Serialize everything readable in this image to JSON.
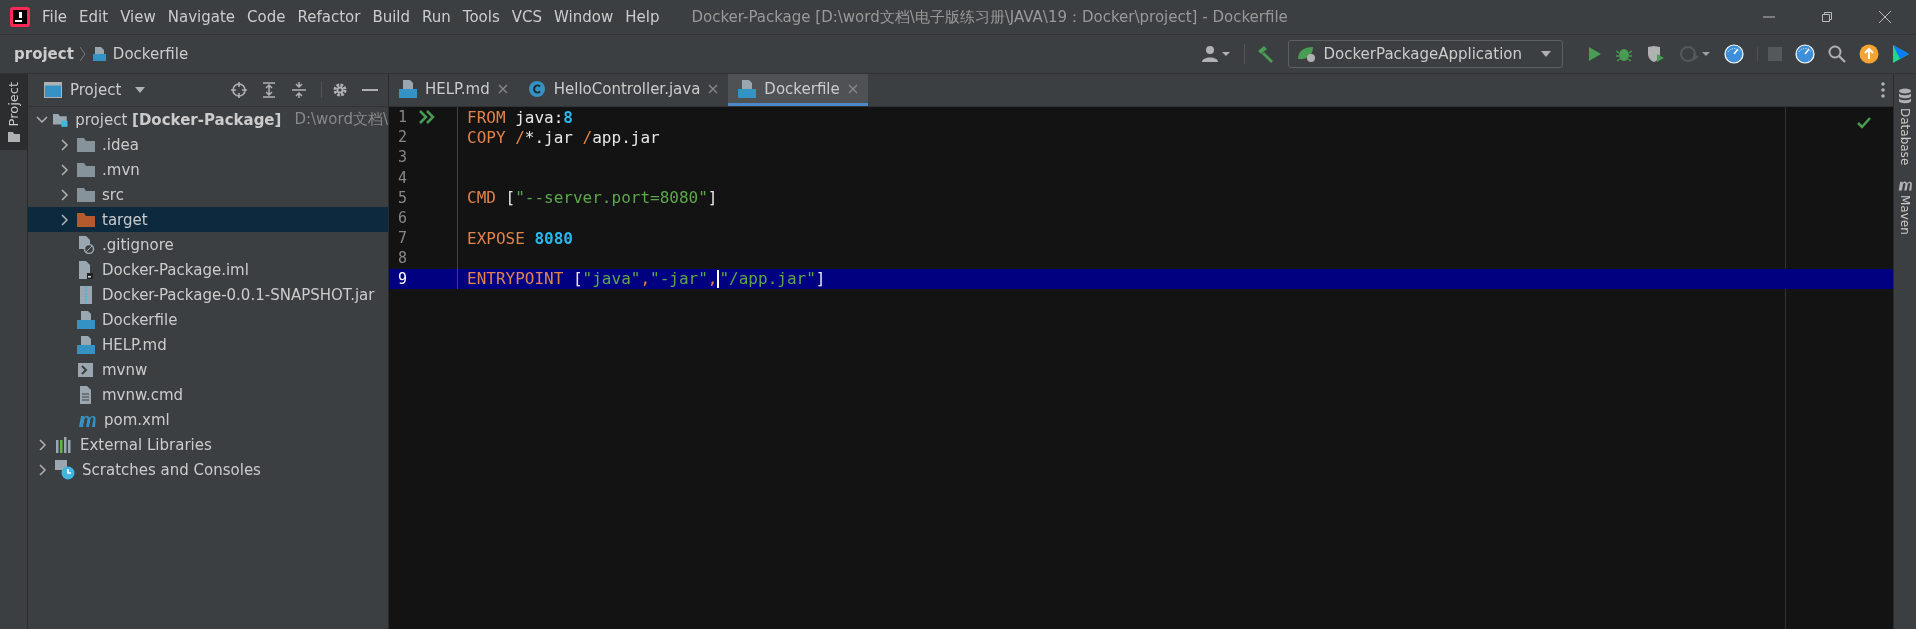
{
  "window": {
    "title": "Docker-Package [D:\\word文档\\电子版练习册\\JAVA\\19：Docker\\project] - Dockerfile"
  },
  "menu": [
    "File",
    "Edit",
    "View",
    "Navigate",
    "Code",
    "Refactor",
    "Build",
    "Run",
    "Tools",
    "VCS",
    "Window",
    "Help"
  ],
  "breadcrumb": [
    {
      "label": "project",
      "kind": "project"
    },
    {
      "label": "Dockerfile",
      "kind": "docker"
    }
  ],
  "toolbar": [
    {
      "kind": "user",
      "disabled": false
    },
    {
      "kind": "build",
      "disabled": false
    },
    {
      "kind": "config",
      "label": "DockerPackageApplication",
      "disabled": false
    },
    {
      "kind": "run",
      "disabled": false
    },
    {
      "kind": "debug",
      "disabled": false
    },
    {
      "kind": "coverage",
      "disabled": false
    },
    {
      "kind": "profile",
      "disabled": true
    },
    {
      "kind": "gauge",
      "disabled": false
    },
    {
      "kind": "stop",
      "disabled": true
    },
    {
      "kind": "gauge",
      "disabled": false
    },
    {
      "kind": "search",
      "disabled": false
    },
    {
      "kind": "update",
      "disabled": false
    },
    {
      "kind": "toolbox",
      "disabled": false
    }
  ],
  "left_strip": [
    {
      "label": "Project",
      "selected": true
    }
  ],
  "right_strip": [
    {
      "label": "Database",
      "kind": "database"
    },
    {
      "label": "Maven",
      "kind": "maven"
    }
  ],
  "project_panel": {
    "title": "Project",
    "tree": [
      {
        "label": "project **[Docker-Package]**",
        "path": "D:\\word文档\\",
        "kind": "module",
        "expanded": true,
        "selected": false,
        "children": [
          {
            "label": ".idea",
            "kind": "folder",
            "expanded": false,
            "selected": false
          },
          {
            "label": ".mvn",
            "kind": "folder",
            "expanded": false,
            "selected": false
          },
          {
            "label": "src",
            "kind": "folder",
            "expanded": false,
            "selected": false
          },
          {
            "label": "target",
            "kind": "excluded",
            "expanded": false,
            "selected": true
          },
          {
            "label": ".gitignore",
            "kind": "gitignore",
            "selected": false
          },
          {
            "label": "Docker-Package.iml",
            "kind": "iml",
            "selected": false
          },
          {
            "label": "Docker-Package-0.0.1-SNAPSHOT.jar",
            "kind": "jar",
            "selected": false
          },
          {
            "label": "Dockerfile",
            "kind": "docker",
            "selected": false
          },
          {
            "label": "HELP.md",
            "kind": "md",
            "selected": false
          },
          {
            "label": "mvnw",
            "kind": "shell",
            "selected": false
          },
          {
            "label": "mvnw.cmd",
            "kind": "text",
            "selected": false
          },
          {
            "label": "pom.xml",
            "kind": "maven",
            "selected": false
          }
        ]
      },
      {
        "label": "External Libraries",
        "kind": "libraries",
        "expanded": false,
        "selected": false
      },
      {
        "label": "Scratches and Consoles",
        "kind": "scratches",
        "expanded": false,
        "selected": false
      }
    ]
  },
  "tabs": [
    {
      "label": "HELP.md",
      "kind": "md",
      "selected": false
    },
    {
      "label": "HelloController.java",
      "kind": "class",
      "selected": false
    },
    {
      "label": "Dockerfile",
      "kind": "docker",
      "selected": true
    }
  ],
  "editor": {
    "lines": [
      {
        "number": "1",
        "current": false,
        "run": true,
        "tokens": [
          {
            "t": "FROM",
            "kind": "keyword"
          },
          {
            "t": " java:",
            "kind": "plain"
          },
          {
            "t": "8",
            "kind": "number"
          }
        ]
      },
      {
        "number": "2",
        "current": false,
        "run": false,
        "tokens": [
          {
            "t": "COPY /",
            "kind": "keyword"
          },
          {
            "t": "*.jar ",
            "kind": "plain"
          },
          {
            "t": "/",
            "kind": "keyword"
          },
          {
            "t": "app.jar",
            "kind": "plain"
          }
        ]
      },
      {
        "number": "3",
        "current": false,
        "run": false
      },
      {
        "number": "4",
        "current": false,
        "run": false
      },
      {
        "number": "5",
        "current": false,
        "run": false,
        "tokens": [
          {
            "t": "CMD",
            "kind": "keyword"
          },
          {
            "t": " [",
            "kind": "plain"
          },
          {
            "t": "\"--server.port=8080\"",
            "kind": "string"
          },
          {
            "t": "]",
            "kind": "plain"
          }
        ]
      },
      {
        "number": "6",
        "current": false,
        "run": false
      },
      {
        "number": "7",
        "current": false,
        "run": false,
        "tokens": [
          {
            "t": "EXPOSE ",
            "kind": "keyword"
          },
          {
            "t": "8080",
            "kind": "number"
          }
        ]
      },
      {
        "number": "8",
        "current": false,
        "run": false
      },
      {
        "number": "9",
        "current": true,
        "run": false,
        "tokens": [
          {
            "t": "ENTRYPOINT",
            "kind": "keyword"
          },
          {
            "t": " [",
            "kind": "plain"
          },
          {
            "t": "\"java\"",
            "kind": "string"
          },
          {
            "t": ",",
            "kind": "keyword"
          },
          {
            "t": "\"-jar\"",
            "kind": "string"
          },
          {
            "t": ",",
            "kind": "keyword"
          },
          {
            "t": "\"/app.jar\"",
            "kind": "string",
            "caret": true
          },
          {
            "t": "]",
            "kind": "plain"
          }
        ]
      }
    ]
  }
}
